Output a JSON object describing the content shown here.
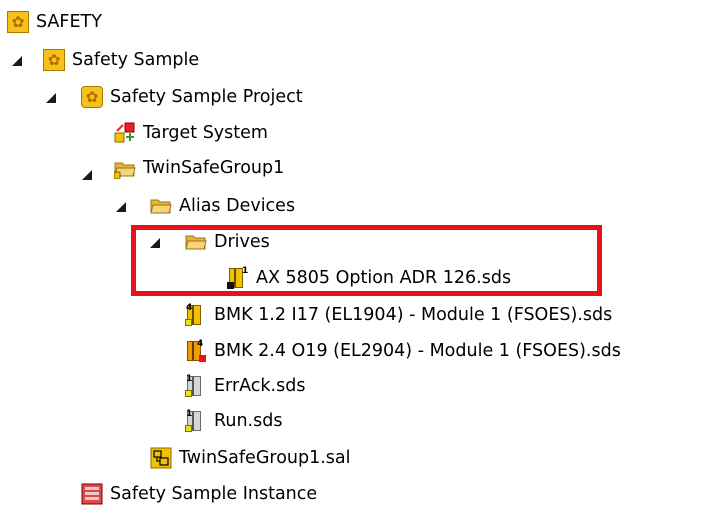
{
  "tree": {
    "root": "SAFETY",
    "project": "Safety Sample",
    "subproject": "Safety Sample Project",
    "target_system": "Target System",
    "group": "TwinSafeGroup1",
    "alias_devices": "Alias Devices",
    "drives": "Drives",
    "ax": "AX 5805 Option ADR 126.sds",
    "bmk1": "BMK 1.2 I17 (EL1904) - Module 1 (FSOES).sds",
    "bmk2": "BMK 2.4 O19 (EL2904) - Module 1 (FSOES).sds",
    "errack": "ErrAck.sds",
    "run": "Run.sds",
    "sal": "TwinSafeGroup1.sal",
    "instance": "Safety Sample Instance"
  },
  "icons": {
    "root": "gear-icon",
    "project": "gear-icon",
    "subproject": "gear-icon",
    "target_system": "target-system-icon",
    "group": "group-folder-icon",
    "alias_devices": "folder-icon",
    "drives": "folder-icon",
    "ax": "safety-module-icon",
    "bmk1": "input-module-icon",
    "bmk2": "output-module-icon",
    "errack": "variable-module-icon",
    "run": "variable-module-icon",
    "sal": "alias-file-icon",
    "instance": "instance-icon"
  },
  "colors": {
    "highlight": "#e8101b",
    "module_yellow": "#f2c200",
    "folder": "#e9b43a"
  }
}
